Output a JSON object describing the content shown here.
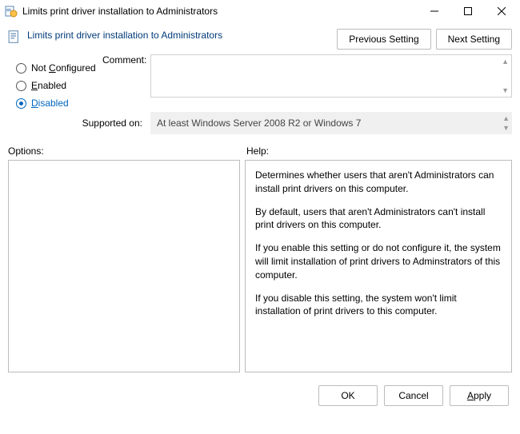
{
  "titlebar": {
    "title": "Limits print driver installation to Administrators"
  },
  "header": {
    "title": "Limits print driver installation to Administrators",
    "prev": "Previous Setting",
    "next": "Next Setting"
  },
  "state": {
    "not_configured": "Not Configured",
    "enabled": "Enabled",
    "disabled": "Disabled",
    "comment_label": "Comment:",
    "supported_label": "Supported on:",
    "supported_value": "At least Windows Server 2008 R2 or Windows 7"
  },
  "labels": {
    "options": "Options:",
    "help": "Help:"
  },
  "help": {
    "p1": "Determines whether users that aren't Administrators can install print drivers on this computer.",
    "p2": "By default, users that aren't Administrators can't install print drivers on this computer.",
    "p3": "If you enable this setting or do not configure it, the system will limit installation of print drivers to Adminstrators of this computer.",
    "p4": "If you disable this setting, the system won't limit installation of print drivers to this computer."
  },
  "buttons": {
    "ok": "OK",
    "cancel": "Cancel",
    "apply": "Apply"
  }
}
